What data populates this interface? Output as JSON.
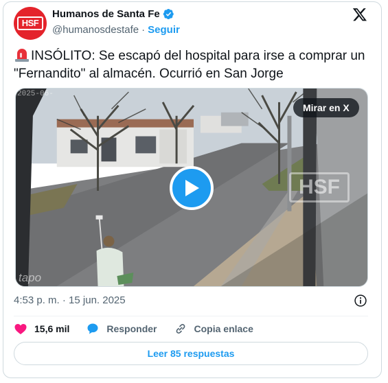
{
  "account": {
    "display_name": "Humanos de Santa Fe",
    "handle": "@humanosdestafe",
    "separator": "·",
    "follow_label": "Seguir",
    "avatar_text": "HSF",
    "verified": true,
    "verified_color": "#1d9bf0",
    "avatar_color": "#e4232b"
  },
  "tweet": {
    "leading_emoji": "rotating-light-icon",
    "text": "INSÓLITO: Se escapó del hospital para irse a comprar un \"Fernandito\" al almacén. Ocurrió en San Jorge"
  },
  "media": {
    "type": "video",
    "watch_on_x_label": "Mirar en X",
    "overlay_timestamp": "2025-06-",
    "watermark_text": "HSF",
    "camera_brand": "tapo"
  },
  "meta": {
    "time": "4:53 p. m.",
    "separator": "·",
    "date": "15 jun. 2025"
  },
  "actions": {
    "likes_count": "15,6 mil",
    "reply_label": "Responder",
    "copy_link_label": "Copia enlace",
    "like_color": "#f91880"
  },
  "footer": {
    "read_replies_label": "Leer 85 respuestas"
  },
  "colors": {
    "accent": "#1d9bf0",
    "text_primary": "#0f1419",
    "text_secondary": "#536471",
    "border": "#cfd9de"
  }
}
